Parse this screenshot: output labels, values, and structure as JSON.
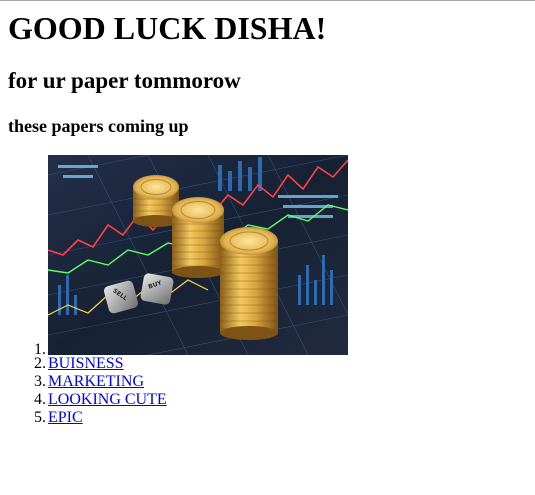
{
  "heading": "GOOD LUCK DISHA!",
  "subheading": "for ur paper tommorow",
  "subsubheading": "these papers coming up",
  "list": {
    "items": [
      {
        "num": "1.",
        "type": "image",
        "image_icon": "finance-coins-chart-image",
        "dice_top_text": "BUY",
        "dice_side_text": "SELL"
      },
      {
        "num": "2.",
        "label": "BUISNESS"
      },
      {
        "num": "3.",
        "label": "MARKETING"
      },
      {
        "num": "4.",
        "label": "LOOKING CUTE"
      },
      {
        "num": "5.",
        "label": "EPIC"
      }
    ]
  },
  "colors": {
    "link": "#0000ee",
    "text": "#000000",
    "background": "#ffffff"
  }
}
